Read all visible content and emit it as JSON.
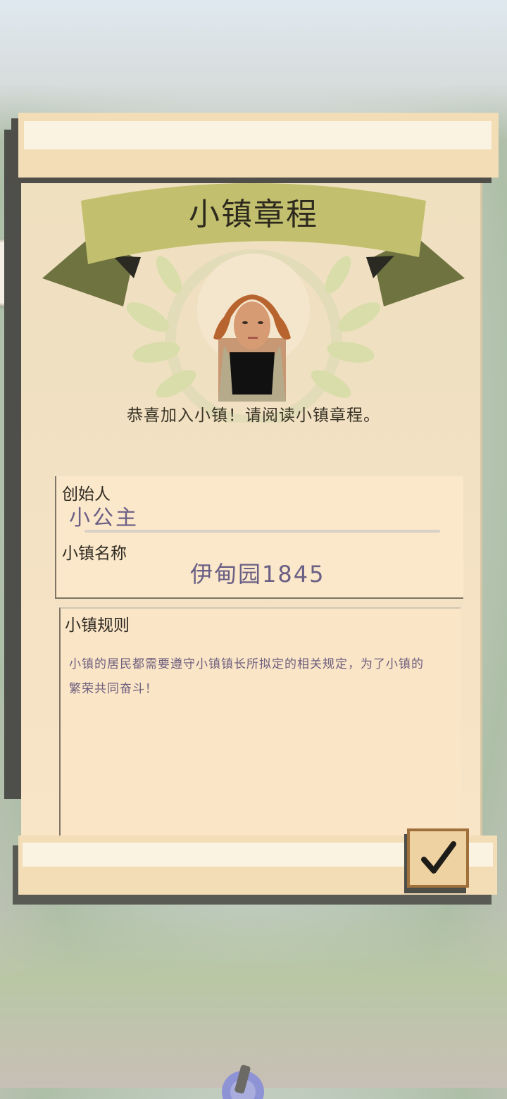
{
  "charter": {
    "title": "小镇章程",
    "welcome": "恭喜加入小镇！请阅读小镇章程。",
    "founder_label": "创始人",
    "founder_name": "小公主",
    "town_name_label": "小镇名称",
    "town_name": "伊甸园1845",
    "rules_label": "小镇规则",
    "rules_text": "小镇的居民都需要遵守小镇镇长所拟定的相关规定，为了小镇的繁荣共同奋斗！"
  },
  "colors": {
    "paper": "#f5e2c4",
    "ribbon": "#c2c06e",
    "ribbon_dark": "#6f7340",
    "handwriting": "#6a5f85",
    "accent_orange": "#f0a423",
    "notification_dot": "#f25050"
  },
  "icons": {
    "side_toggle": "chevron-right-icon",
    "confirm": "checkmark-icon"
  }
}
